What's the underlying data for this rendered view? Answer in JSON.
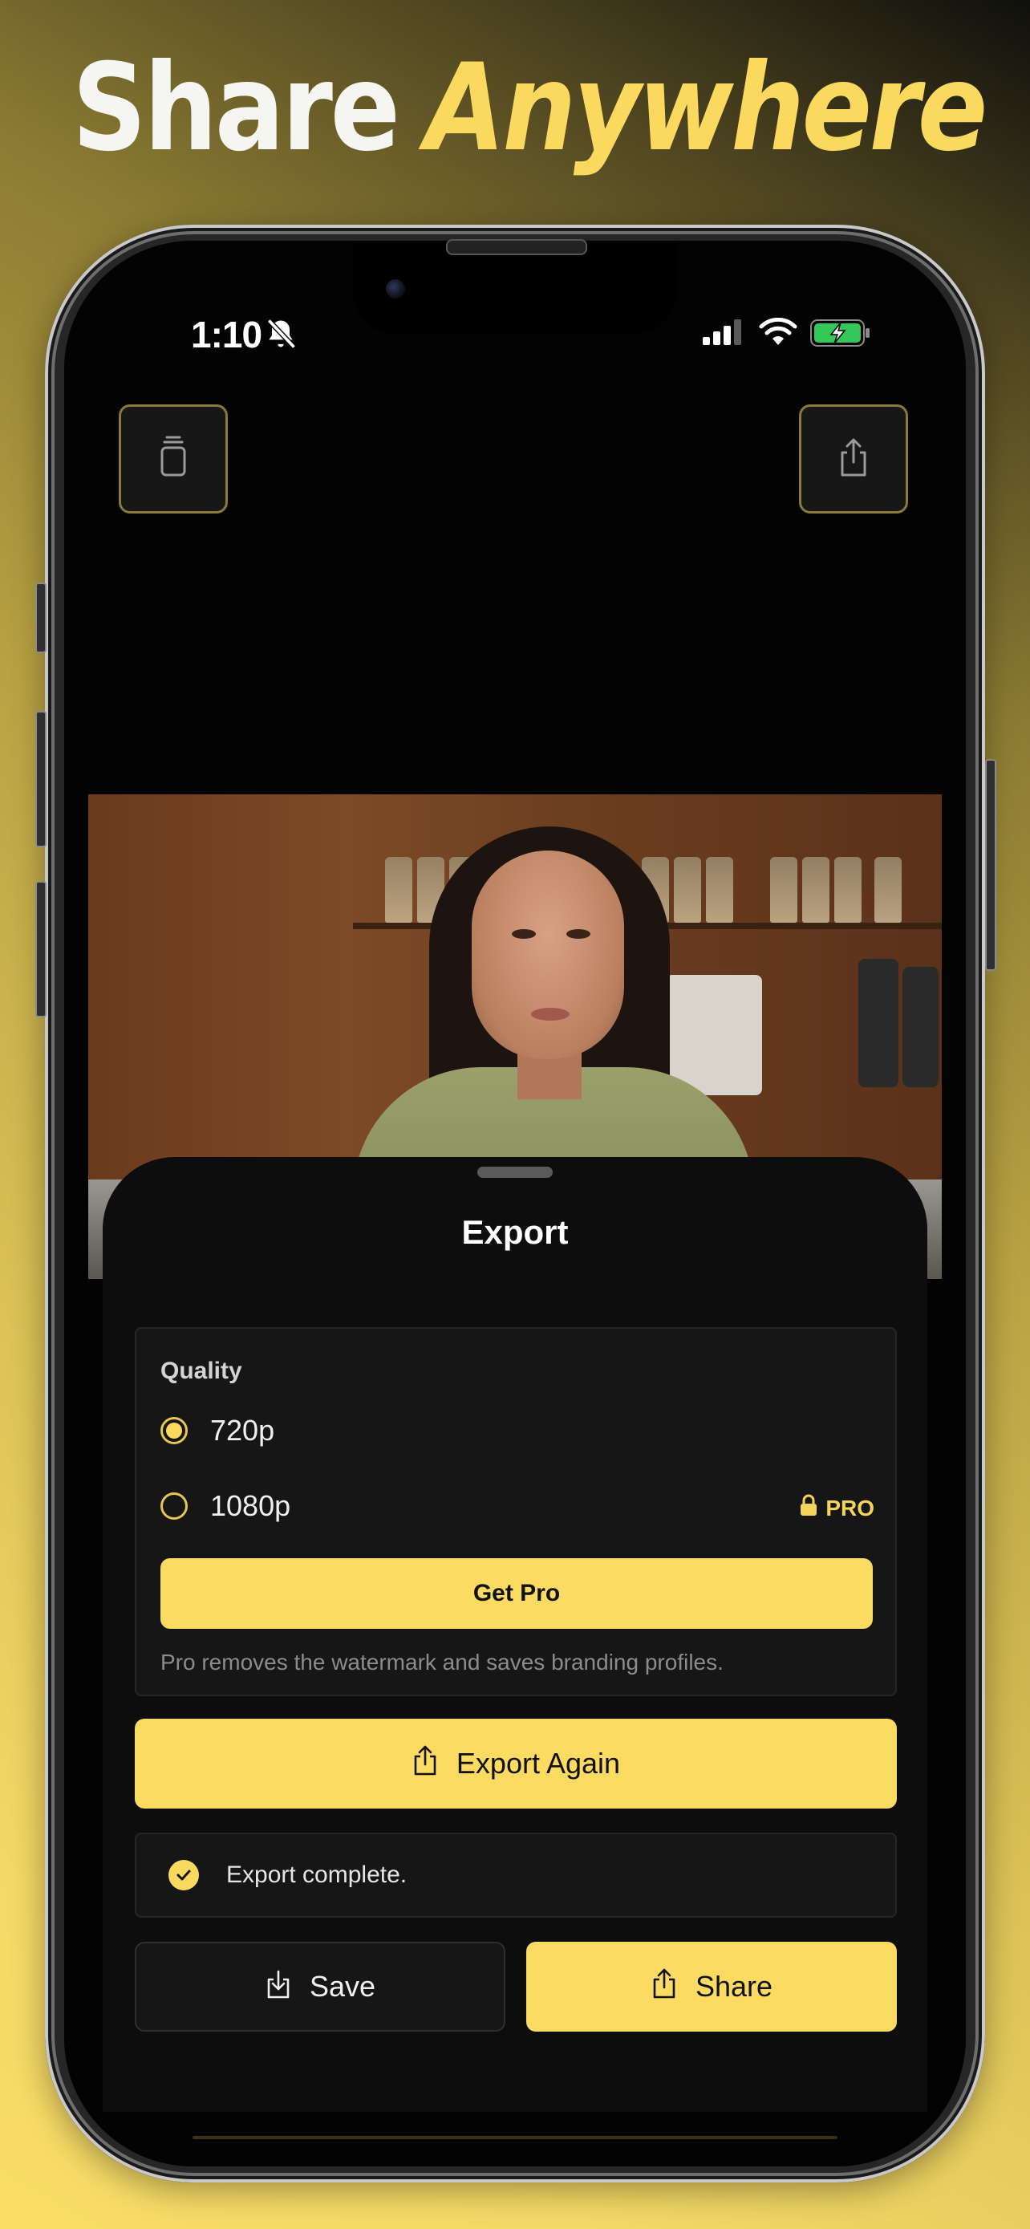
{
  "promo": {
    "headline_word1": "Share",
    "headline_word2": "Anywhere"
  },
  "status_bar": {
    "time": "1:10",
    "icons": [
      "bell-slash-icon",
      "cellular-signal-icon",
      "wifi-icon",
      "battery-charging-icon"
    ]
  },
  "toolbar": {
    "left_icon": "clipboard-icon",
    "right_icon": "share-icon"
  },
  "sheet": {
    "title": "Export",
    "quality": {
      "label": "Quality",
      "options": [
        {
          "label": "720p",
          "selected": true
        },
        {
          "label": "1080p",
          "selected": false,
          "badge": "PRO"
        }
      ],
      "get_pro_label": "Get Pro",
      "note": "Pro removes the watermark and saves branding profiles."
    },
    "export_again_label": "Export Again",
    "status_message": "Export complete.",
    "save_label": "Save",
    "share_label": "Share"
  },
  "colors": {
    "accent": "#fcdb62",
    "background": "#0d0d0d",
    "card": "#161616"
  }
}
